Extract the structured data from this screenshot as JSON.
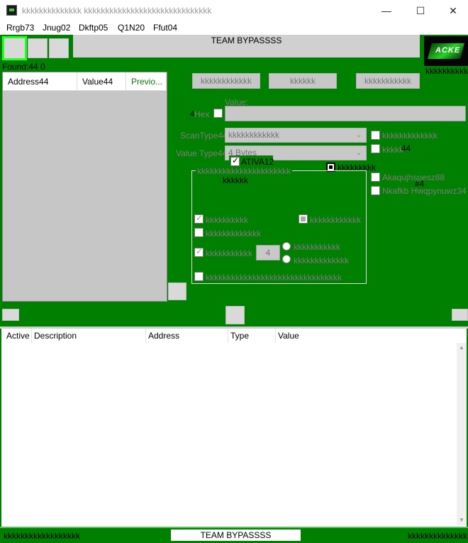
{
  "window": {
    "title": "kkkkkkkkkkkkkk kkkkkkkkkkkkkkkkkkkkkkkkkkkkkk",
    "minimize": "—",
    "maximize": "☐",
    "close": "✕"
  },
  "menu": [
    "Rrgb73",
    "Jnug02",
    "Dkftp05",
    "Q1N20",
    "Ffut04"
  ],
  "header": {
    "title": "TEAM BYPASSSS",
    "logo_text": "ACKE",
    "logo_caption": "kkkkkkkkkkk",
    "found_label": "Found:44 0"
  },
  "results": {
    "columns": [
      "Address44",
      "Value44",
      "Previo..."
    ]
  },
  "scan_buttons": [
    "kkkkkkkkkkkk",
    "kkkkkk",
    "kkkkkkkkkkk"
  ],
  "value": {
    "label": "Value:",
    "hex_label": "Hex",
    "hex_prefix": "4"
  },
  "scan_type": {
    "label": "ScanType44",
    "selected": "kkkkkkkkkkkk"
  },
  "value_type": {
    "label": "Value Type44",
    "selected": "4 Bytes"
  },
  "right_options": {
    "opt1": "kkkkkkkkkkkkk",
    "opt2": "kkkkk",
    "opt2_suffix": "44",
    "opt3": "Akaqujhspesz88",
    "opt3_suffix": "#4",
    "opt4": "Nkafkb Hwqpynuwz34"
  },
  "overlay": {
    "ativa_label": "ATIVA12",
    "group_sub": "kkkkkk",
    "black_check_label": "kkkkkkkkk"
  },
  "memory_group": {
    "title": "kkkkkkkkkkkkkkkkkkkkkk",
    "opt_a": "kkkkkkkkkk",
    "opt_b": "kkkkkkkkkkkk",
    "opt_c": "kkkkkkkkkkkkk",
    "opt_d": "kkkkkkkkkkk",
    "opt_d_value": "4",
    "radio_1": "kkkkkkkkkkk",
    "radio_2": "kkkkkkkkkkkkk",
    "opt_e": "kkkkkkkkkkkkkkkkkkkkkkkkkkkkkkkk"
  },
  "address_list": {
    "columns": [
      "Active",
      "Description",
      "Address",
      "Type",
      "Value"
    ]
  },
  "statusbar": {
    "left": "kkkkkkkkkkkkkkkkkk",
    "center": "TEAM BYPASSSS",
    "right": "kkkkkkkkkkkkkkk"
  },
  "colors": {
    "main_green": "#008000",
    "highlight_green": "#22ff22",
    "panel_gray": "#c7c7c7"
  }
}
